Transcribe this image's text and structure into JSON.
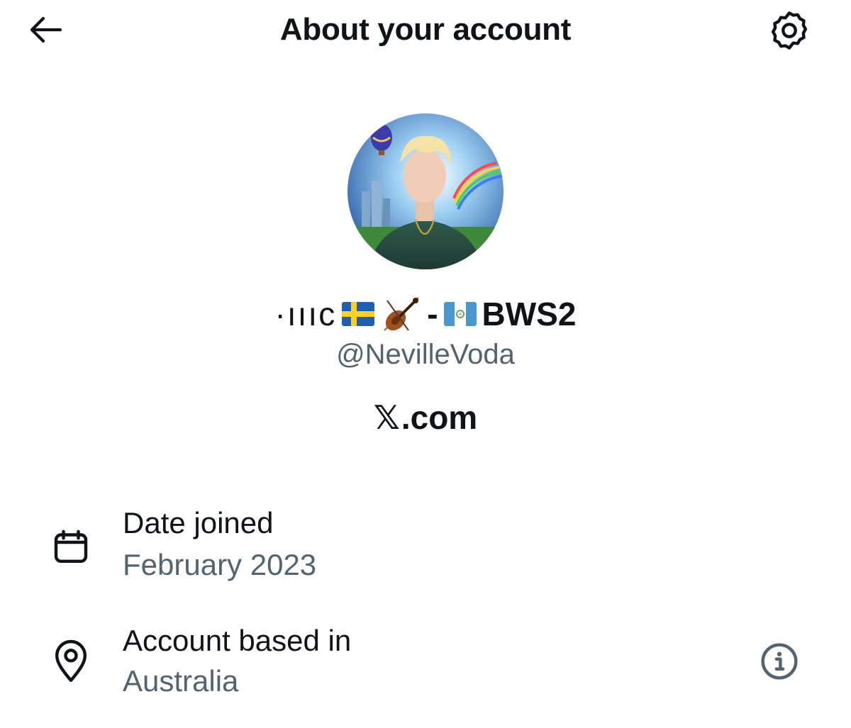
{
  "header": {
    "title": "About your account",
    "back_icon": "arrow-left-icon",
    "settings_icon": "gear-icon"
  },
  "profile": {
    "avatar_icon": "profile-photo",
    "display_name_prefix": "·ıııc",
    "display_name_emoji_1": "sweden-flag",
    "display_name_emoji_2": "violin",
    "display_name_separator": "-",
    "display_name_emoji_3": "guatemala-flag",
    "display_name_suffix": "BWS2",
    "handle": "@NevilleVoda",
    "source_mark": "𝕏",
    "source_domain": ".com"
  },
  "details": {
    "date_joined": {
      "icon": "calendar-icon",
      "label": "Date joined",
      "value": "February 2023"
    },
    "account_based_in": {
      "icon": "location-pin-icon",
      "label": "Account based in",
      "value": "Australia",
      "info_icon": "info-icon"
    }
  },
  "colors": {
    "text_primary": "#0f1419",
    "text_secondary": "#536471",
    "background": "#ffffff"
  }
}
